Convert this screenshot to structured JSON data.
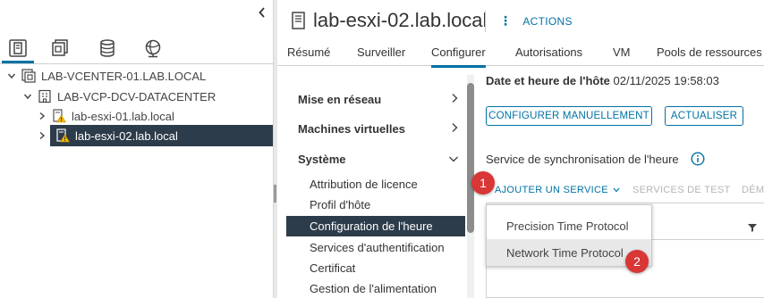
{
  "inventory": {
    "tree": [
      {
        "label": "LAB-VCENTER-01.LAB.LOCAL",
        "expanded": true,
        "icon": "vcenter-icon"
      },
      {
        "label": "LAB-VCP-DCV-DATACENTER",
        "expanded": true,
        "icon": "datacenter-icon"
      },
      {
        "label": "lab-esxi-01.lab.local",
        "expanded": false,
        "icon": "host-warning-icon"
      },
      {
        "label": "lab-esxi-02.lab.local",
        "expanded": false,
        "icon": "host-warning-icon",
        "selected": true
      }
    ]
  },
  "header": {
    "host_name": "lab-esxi-02.lab.local",
    "actions_label": "ACTIONS"
  },
  "tabs": [
    {
      "label": "Résumé"
    },
    {
      "label": "Surveiller"
    },
    {
      "label": "Configurer",
      "active": true
    },
    {
      "label": "Autorisations"
    },
    {
      "label": "VM"
    },
    {
      "label": "Pools de ressources"
    }
  ],
  "config_nav": {
    "groups": [
      {
        "label": "Mise en réseau",
        "expanded": false
      },
      {
        "label": "Machines virtuelles",
        "expanded": false
      },
      {
        "label": "Système",
        "expanded": true
      }
    ],
    "system_items": [
      {
        "label": "Attribution de licence"
      },
      {
        "label": "Profil d'hôte"
      },
      {
        "label": "Configuration de l'heure",
        "selected": true
      },
      {
        "label": "Services d'authentification"
      },
      {
        "label": "Certificat"
      },
      {
        "label": "Gestion de l'alimentation"
      }
    ]
  },
  "time_config": {
    "date_label": "Date et heure de l'hôte",
    "date_value": "02/11/2025 19:58:03",
    "manual_button": "CONFIGURER MANUELLEMENT",
    "refresh_button": "ACTUALISER",
    "sync_service_label": "Service de synchronisation de l'heure",
    "add_service_label": "AJOUTER UN SERVICE",
    "test_services_label": "SERVICES DE TEST",
    "truncated_label": "DÉM",
    "dropdown_options": [
      {
        "label": "Precision Time Protocol"
      },
      {
        "label": "Network Time Protocol",
        "hovered": true
      }
    ]
  },
  "step_badges": [
    "1",
    "2"
  ],
  "colors": {
    "accent": "#0072a3",
    "selected_bg": "#2d3c4a",
    "badge": "#d93636",
    "warning": "#f5b800"
  }
}
